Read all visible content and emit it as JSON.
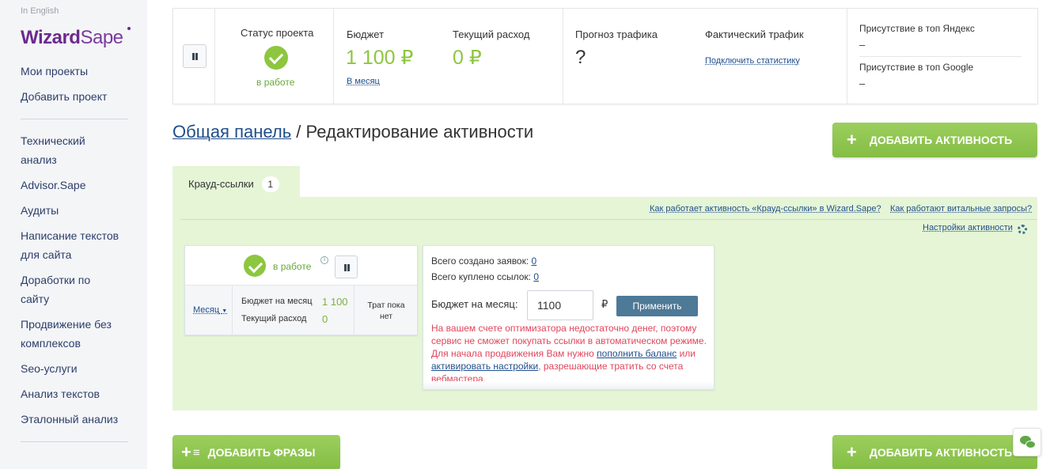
{
  "sidebar": {
    "lang_link": "In English",
    "logo": {
      "part1": "Wizard",
      "part2": "Sape"
    },
    "top_items": [
      "Мои проекты",
      "Добавить проект"
    ],
    "items": [
      {
        "line1": "Технический",
        "line2": "анализ"
      },
      {
        "line1": "Advisor.Sape",
        "line2": ""
      },
      {
        "line1": "Аудиты",
        "line2": ""
      },
      {
        "line1": "Написание текстов",
        "line2": "для сайта"
      },
      {
        "line1": "Доработки по",
        "line2": "сайту"
      },
      {
        "line1": "Продвижение без",
        "line2": "комплексов"
      },
      {
        "line1": "Seo-услуги",
        "line2": ""
      },
      {
        "line1": "Анализ текстов",
        "line2": ""
      },
      {
        "line1": "Эталонный анализ",
        "line2": ""
      }
    ]
  },
  "status_bar": {
    "project_status_label": "Статус проекта",
    "project_status_value": "в работе",
    "budget_label": "Бюджет",
    "budget_value": "1 100 ₽",
    "budget_period": "В месяц",
    "spend_label": "Текущий расход",
    "spend_value": "0 ₽",
    "forecast_label": "Прогноз трафика",
    "forecast_value": "?",
    "actual_label": "Фактический трафик",
    "actual_link": "Подключить статистику",
    "yandex_label": "Присутствие в топ Яндекс",
    "yandex_value": "–",
    "google_label": "Присутствие в топ Google",
    "google_value": "–"
  },
  "heading": {
    "crumb": "Общая панель",
    "separator": " / ",
    "title": "Редактирование активности"
  },
  "buttons": {
    "add_activity": "ДОБАВИТЬ АКТИВНОСТЬ",
    "add_phrases": "ДОБАВИТЬ ФРАЗЫ",
    "add_activity_bottom": "ДОБАВИТЬ АКТИВНОСТЬ"
  },
  "tab": {
    "label": "Крауд-ссылки",
    "count": "1"
  },
  "panel_links": {
    "how_activity": "Как работает активность «Крауд-ссылки» в Wizard.Sape?",
    "how_vital": "Как работают витальные запросы?",
    "settings": "Настройки активности"
  },
  "activity_card": {
    "status": "в работе",
    "info": "i",
    "period": "Месяц",
    "budget_label": "Бюджет на месяц",
    "budget_value": "1 100",
    "spend_label": "Текущий расход",
    "spend_value": "0",
    "no_spend_line1": "Трат пока",
    "no_spend_line2": "нет"
  },
  "details": {
    "requests_label": "Всего создано заявок:",
    "requests_value": "0",
    "links_label": "Всего куплено ссылок:",
    "links_value": "0",
    "budget_label": "Бюджет на месяц:",
    "budget_input": "1100",
    "currency": "₽",
    "apply": "Применить",
    "warn_part1": "На вашем счете оптимизатора недостаточно денег, поэтому сервис не сможет покупать ссылки в автоматическом режиме. Для начала продвижения Вам нужно ",
    "warn_link1": "пополнить баланс",
    "warn_part2": " или ",
    "warn_link2": "активировать настройки",
    "warn_part3": ", разрешающие тратить со счета вебмастера."
  },
  "colors": {
    "accent_green": "#8dc63f",
    "brand_purple": "#6b2a8e",
    "link_blue": "#1f4e8c",
    "warning_red": "#e0455c",
    "panel_bg": "#e5f5d6"
  }
}
